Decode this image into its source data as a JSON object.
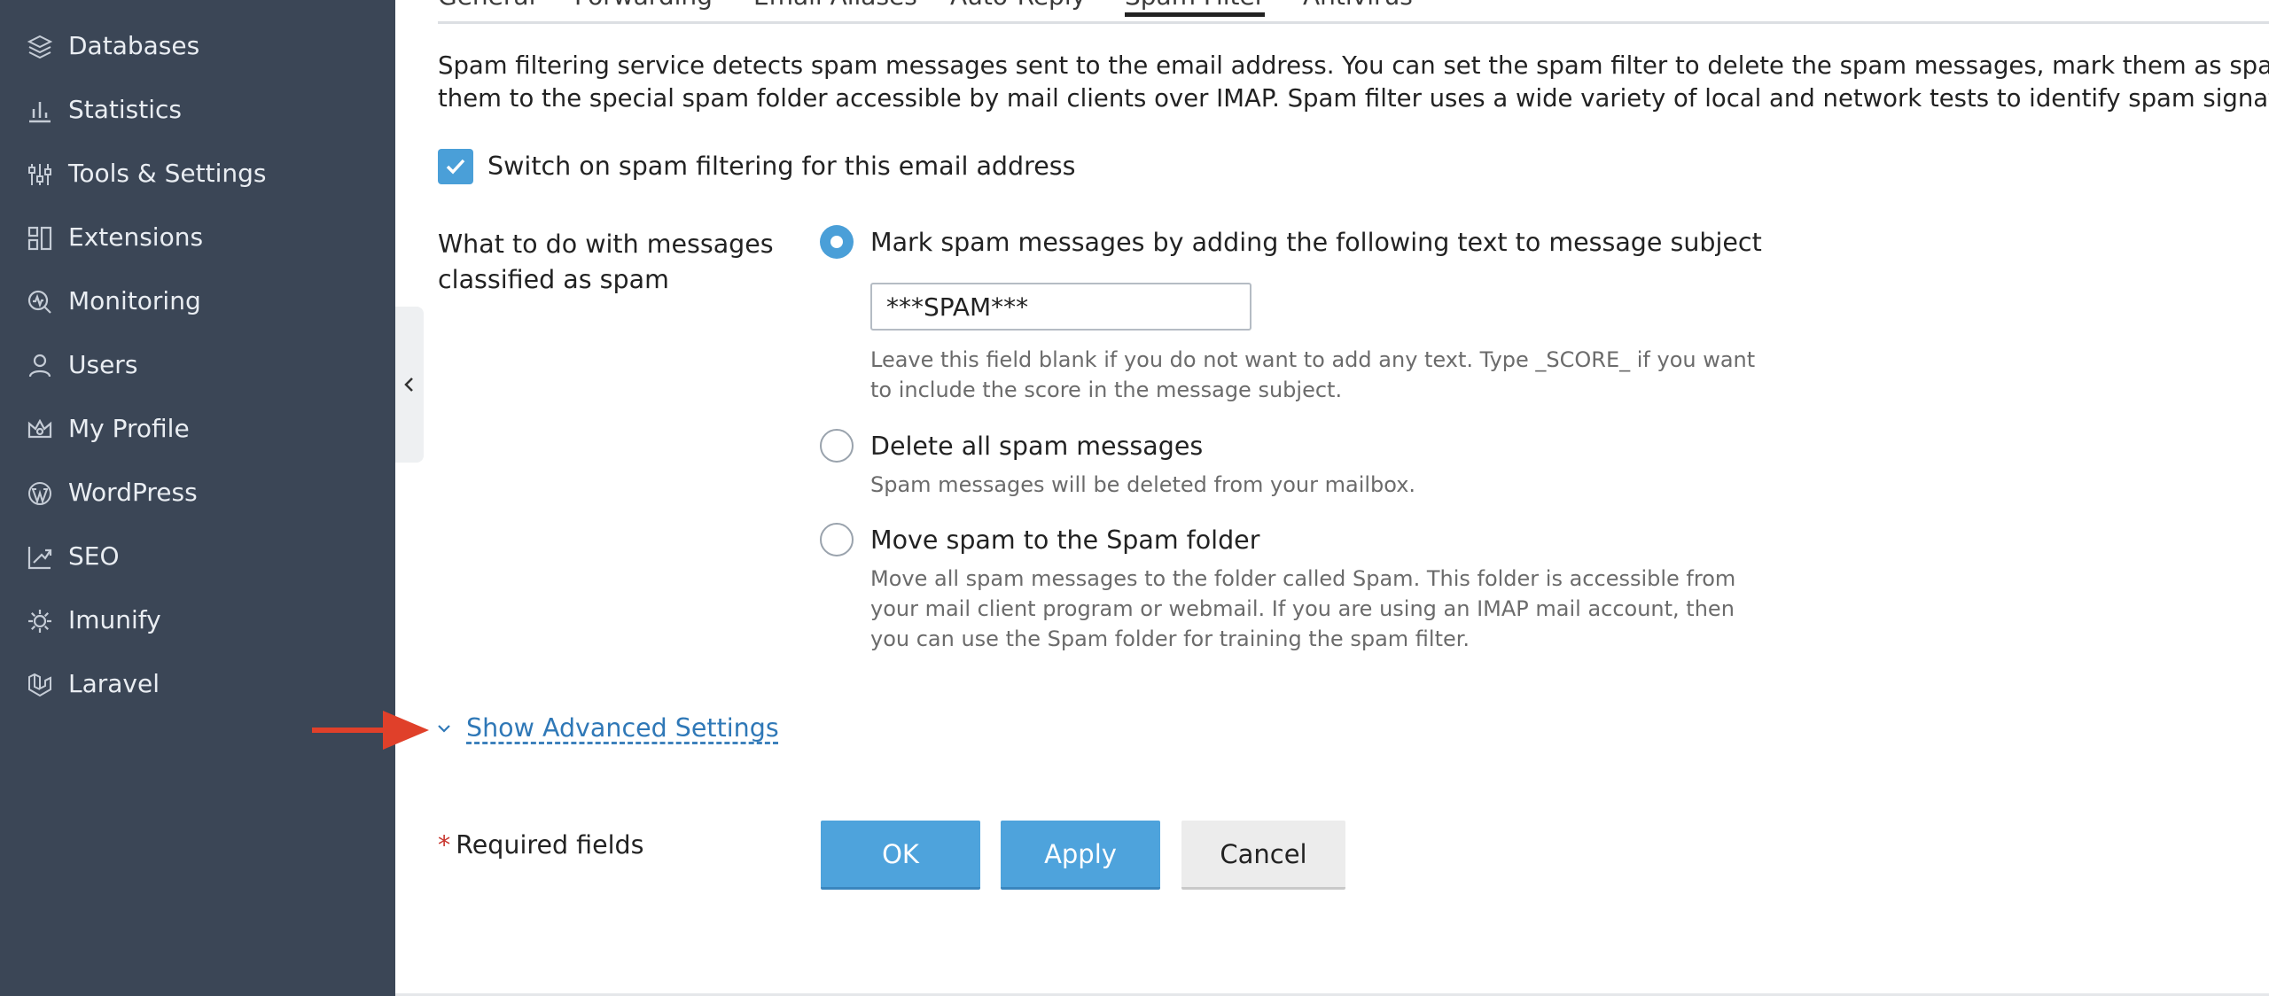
{
  "sidebar": {
    "items": [
      {
        "label": "Databases",
        "icon": "database-icon"
      },
      {
        "label": "Statistics",
        "icon": "bar-chart-icon"
      },
      {
        "label": "Tools & Settings",
        "icon": "sliders-icon"
      },
      {
        "label": "Extensions",
        "icon": "extensions-icon"
      },
      {
        "label": "Monitoring",
        "icon": "monitoring-icon"
      },
      {
        "label": "Users",
        "icon": "user-icon"
      },
      {
        "label": "My Profile",
        "icon": "crown-icon"
      },
      {
        "label": "WordPress",
        "icon": "wordpress-icon"
      },
      {
        "label": "SEO",
        "icon": "seo-chart-icon"
      },
      {
        "label": "Imunify",
        "icon": "gear-icon"
      },
      {
        "label": "Laravel",
        "icon": "laravel-icon"
      }
    ]
  },
  "tabs": [
    {
      "label": "General"
    },
    {
      "label": "Forwarding"
    },
    {
      "label": "Email Aliases"
    },
    {
      "label": "Auto-Reply"
    },
    {
      "label": "Spam Filter",
      "active": true
    },
    {
      "label": "Antivirus"
    }
  ],
  "description": {
    "line1": "Spam filtering service detects spam messages sent to the email address. You can set the spam filter to delete the spam messages, mark them as spam by changing",
    "line2": "them to the special spam folder accessible by mail clients over IMAP. Spam filter uses a wide variety of local and network tests to identify spam signatures."
  },
  "enable_filter": {
    "label": "Switch on spam filtering for this email address",
    "checked": true
  },
  "spam_action": {
    "label": "What to do with messages classified as spam",
    "options": [
      {
        "label": "Mark spam messages by adding the following text to message subject",
        "checked": true,
        "hint": "Leave this field blank if you do not want to add any text. Type _SCORE_ if you want to include the score in the message subject."
      },
      {
        "label": "Delete all spam messages",
        "checked": false,
        "hint": "Spam messages will be deleted from your mailbox."
      },
      {
        "label": "Move spam to the Spam folder",
        "checked": false,
        "hint": "Move all spam messages to the folder called Spam. This folder is accessible from your mail client program or webmail. If you are using an IMAP mail account, then you can use the Spam folder for training the spam filter."
      }
    ],
    "subject_text_value": "***SPAM***"
  },
  "advanced_link": "Show Advanced Settings",
  "required": {
    "star": "*",
    "label": "Required fields"
  },
  "buttons": {
    "ok": "OK",
    "apply": "Apply",
    "cancel": "Cancel"
  },
  "colors": {
    "sidebar_bg": "#3b4656",
    "accent": "#4a9fd8",
    "link": "#2f78b7",
    "annotation_arrow": "#e0402a"
  }
}
